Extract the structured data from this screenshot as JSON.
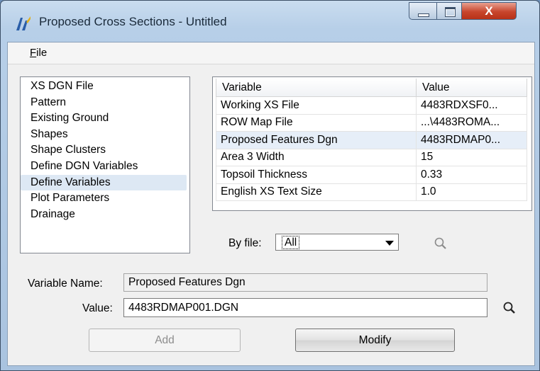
{
  "window": {
    "title": "Proposed Cross Sections - Untitled",
    "close_glyph": "X"
  },
  "menu": {
    "file_label": "File"
  },
  "list": {
    "items": [
      "XS DGN File",
      "Pattern",
      "Existing Ground",
      "Shapes",
      "Shape Clusters",
      "Define DGN Variables",
      "Define Variables",
      "Plot Parameters",
      "Drainage"
    ],
    "selected": "Define Variables"
  },
  "grid": {
    "columns": [
      "Variable",
      "Value"
    ],
    "rows": [
      [
        "Working XS File",
        "4483RDXSF0..."
      ],
      [
        "ROW Map File",
        "...\\4483ROMA..."
      ],
      [
        "Proposed Features Dgn",
        "4483RDMAP0..."
      ],
      [
        "Area 3 Width",
        "15"
      ],
      [
        "Topsoil Thickness",
        "0.33"
      ],
      [
        "English XS Text Size",
        "1.0"
      ]
    ],
    "selected_row": 2
  },
  "filter": {
    "label": "By file:",
    "value": "All"
  },
  "fields": {
    "variable_name_label": "Variable Name:",
    "variable_name_value": "Proposed Features Dgn",
    "value_label": "Value:",
    "value_value": "4483RDMAP001.DGN"
  },
  "buttons": {
    "add_label": "Add",
    "modify_label": "Modify"
  },
  "icons": {
    "app": "app-icon",
    "search": "magnifier-icon",
    "accent": "#c8452c"
  }
}
